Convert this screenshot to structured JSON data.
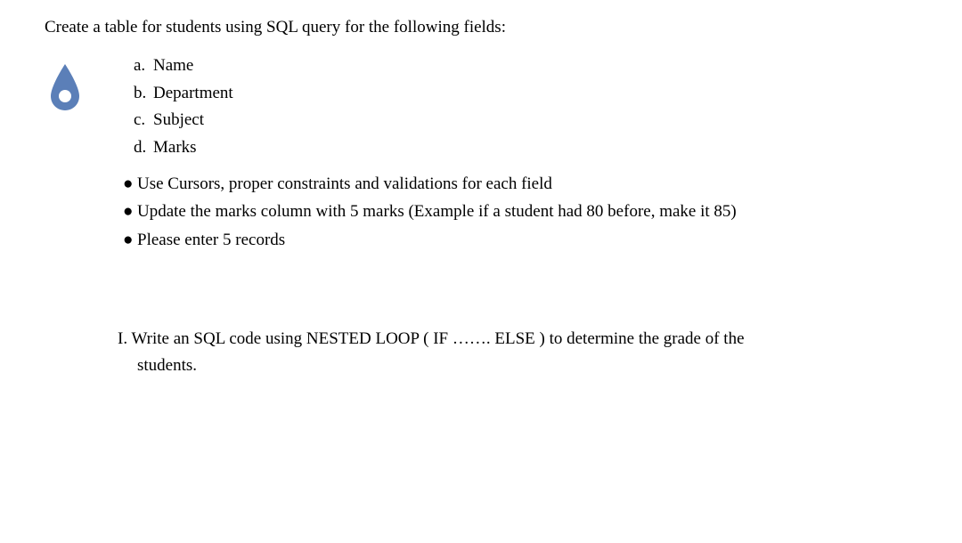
{
  "intro": "Create a table for students using SQL query for the following fields:",
  "fields": [
    {
      "letter": "a.",
      "label": "Name"
    },
    {
      "letter": "b.",
      "label": "Department"
    },
    {
      "letter": "c.",
      "label": "Subject"
    },
    {
      "letter": "d.",
      "label": "Marks"
    }
  ],
  "bullets": [
    "Use Cursors, proper constraints and validations for each field",
    "Update the marks column with 5 marks (Example if a student had 80 before, make it 85)",
    "Please enter 5 records"
  ],
  "question": {
    "numeral": "I.",
    "line1": "Write an SQL code using NESTED LOOP ( IF ……. ELSE ) to determine the grade of the",
    "line2": "students."
  }
}
